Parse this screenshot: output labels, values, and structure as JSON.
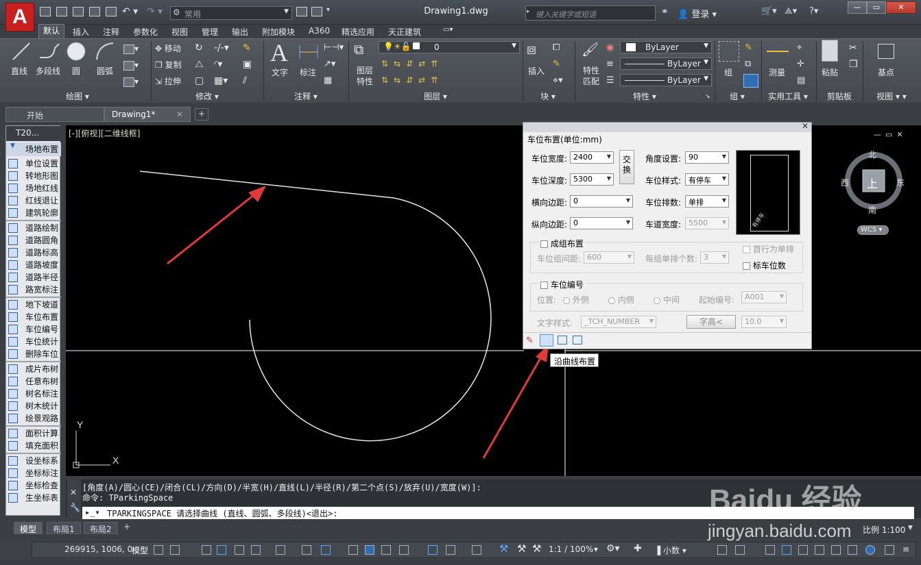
{
  "window": {
    "title": "Drawing1.dwg",
    "workspace": "常用"
  },
  "search": {
    "placeholder": "键入关键字或短语",
    "login": "登录"
  },
  "menus": [
    "默认",
    "插入",
    "注释",
    "参数化",
    "视图",
    "管理",
    "输出",
    "附加模块",
    "A360",
    "精选应用",
    "天正建筑"
  ],
  "ribbon": {
    "draw": {
      "title": "绘图",
      "line": "直线",
      "polyline": "多段线",
      "circle": "圆",
      "arc": "圆弧"
    },
    "modify": {
      "title": "修改",
      "move": "移动",
      "copy": "复制",
      "stretch": "拉伸"
    },
    "annotation": {
      "title": "注释",
      "text": "文字",
      "dim": "标注"
    },
    "layers": {
      "title": "图层",
      "props": "图层\n特性",
      "current": "0"
    },
    "block": {
      "title": "块",
      "insert": "插入"
    },
    "properties": {
      "title": "特性",
      "match": "特性\n匹配",
      "color": "ByLayer",
      "linetype": "ByLayer",
      "lineweight": "ByLayer"
    },
    "groups": {
      "title": "组",
      "group": "组"
    },
    "utilities": {
      "title": "实用工具",
      "measure": "测量"
    },
    "clipboard": {
      "title": "剪贴板",
      "paste": "粘贴"
    },
    "view": {
      "title": "视图",
      "base": "基点"
    }
  },
  "doc_tabs": {
    "start": "开始",
    "drawing": "Drawing1*"
  },
  "left_panel": {
    "header": "T20...",
    "sections": [
      {
        "title": "场地布置",
        "items": [
          "单位设置",
          "转地形图",
          "场地红线",
          "红线退让",
          "建筑轮廓"
        ]
      },
      {
        "title": "",
        "items": [
          "道路绘制",
          "道路圆角",
          "道路标高",
          "道路坡度",
          "道路半径",
          "路宽标注"
        ]
      },
      {
        "title": "",
        "items": [
          "地下坡道",
          "车位布置",
          "车位编号",
          "车位统计",
          "删除车位"
        ]
      },
      {
        "title": "",
        "items": [
          "成片布树",
          "任意布树",
          "树名标注",
          "树木统计",
          "绘景观路"
        ]
      },
      {
        "title": "",
        "items": [
          "面积计算",
          "填充面积"
        ]
      },
      {
        "title": "",
        "items": [
          "设坐标系",
          "坐标标注",
          "坐标检查",
          "生坐标表"
        ]
      }
    ]
  },
  "viewport": {
    "label": "[-][俯视][二维线框]"
  },
  "compass": {
    "north": "北",
    "south": "南",
    "east": "东",
    "west": "西",
    "top": "上",
    "wcs": "WCS"
  },
  "dialog": {
    "title": "车位布置(单位:mm)",
    "width_label": "车位宽度:",
    "width": "2400",
    "depth_label": "车位深度:",
    "depth": "5300",
    "hmargin_label": "横向边距:",
    "hmargin": "0",
    "vmargin_label": "纵向边距:",
    "vmargin": "0",
    "swap": "交\n换",
    "angle_label": "角度设置:",
    "angle": "90",
    "style_label": "车位样式:",
    "style": "有停车",
    "rows_label": "车位排数:",
    "rows": "单排",
    "lane_label": "车道宽度:",
    "lane": "5500",
    "group_chk": "成组布置",
    "group_gap_label": "车位组间距:",
    "group_gap": "600",
    "per_group_label": "每组单排个数:",
    "per_group": "3",
    "first_single": "首行为单排",
    "mark_count": "标车位数",
    "number_chk": "车位编号",
    "pos_label": "位置:",
    "pos_outer": "外侧",
    "pos_inner": "内侧",
    "pos_mid": "中间",
    "start_label": "起始编号:",
    "start": "A001",
    "text_style_label": "文字样式:",
    "text_style": "_TCH_NUMBER",
    "text_height_btn": "字高<",
    "text_height": "10.0",
    "preview_label": "有停车"
  },
  "tooltip": "沿曲线布置",
  "command": {
    "history1": "[角度(A)/圆心(CE)/闭合(CL)/方向(D)/半宽(H)/直线(L)/半径(R)/第二个点(S)/放弃(U)/宽度(W)]:",
    "history2": "命令: TParkingSpace",
    "prompt": "TPARKINGSPACE 请选择曲线 (直线、圆弧、多段线)<退出>:"
  },
  "layout_tabs": [
    "模型",
    "布局1",
    "布局2"
  ],
  "layout_tabs_right": "比例 1:100",
  "status": {
    "coords": "269915, 1006, 0",
    "model": "模型",
    "scale": "1:1 / 100%",
    "units": "小数"
  },
  "watermark": {
    "brand": "Baidu 经验",
    "url": "jingyan.baidu.com"
  }
}
